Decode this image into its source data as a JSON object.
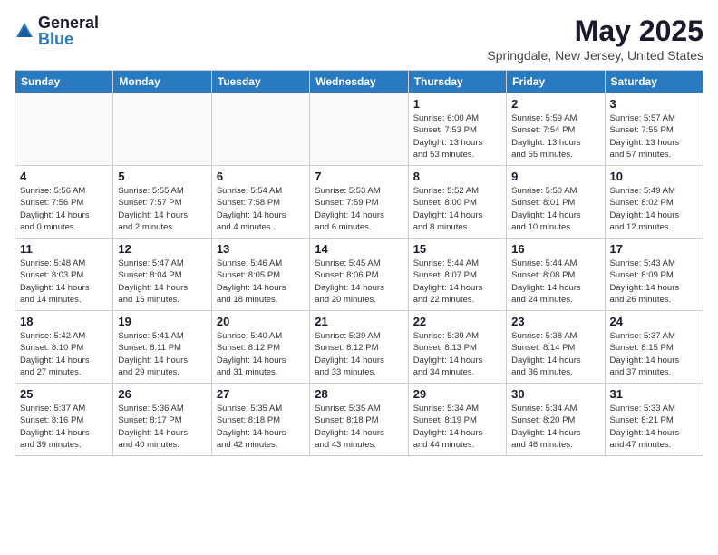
{
  "logo": {
    "general": "General",
    "blue": "Blue"
  },
  "title": {
    "month_year": "May 2025",
    "location": "Springdale, New Jersey, United States"
  },
  "days_of_week": [
    "Sunday",
    "Monday",
    "Tuesday",
    "Wednesday",
    "Thursday",
    "Friday",
    "Saturday"
  ],
  "weeks": [
    [
      {
        "day": "",
        "info": ""
      },
      {
        "day": "",
        "info": ""
      },
      {
        "day": "",
        "info": ""
      },
      {
        "day": "",
        "info": ""
      },
      {
        "day": "1",
        "info": "Sunrise: 6:00 AM\nSunset: 7:53 PM\nDaylight: 13 hours\nand 53 minutes."
      },
      {
        "day": "2",
        "info": "Sunrise: 5:59 AM\nSunset: 7:54 PM\nDaylight: 13 hours\nand 55 minutes."
      },
      {
        "day": "3",
        "info": "Sunrise: 5:57 AM\nSunset: 7:55 PM\nDaylight: 13 hours\nand 57 minutes."
      }
    ],
    [
      {
        "day": "4",
        "info": "Sunrise: 5:56 AM\nSunset: 7:56 PM\nDaylight: 14 hours\nand 0 minutes."
      },
      {
        "day": "5",
        "info": "Sunrise: 5:55 AM\nSunset: 7:57 PM\nDaylight: 14 hours\nand 2 minutes."
      },
      {
        "day": "6",
        "info": "Sunrise: 5:54 AM\nSunset: 7:58 PM\nDaylight: 14 hours\nand 4 minutes."
      },
      {
        "day": "7",
        "info": "Sunrise: 5:53 AM\nSunset: 7:59 PM\nDaylight: 14 hours\nand 6 minutes."
      },
      {
        "day": "8",
        "info": "Sunrise: 5:52 AM\nSunset: 8:00 PM\nDaylight: 14 hours\nand 8 minutes."
      },
      {
        "day": "9",
        "info": "Sunrise: 5:50 AM\nSunset: 8:01 PM\nDaylight: 14 hours\nand 10 minutes."
      },
      {
        "day": "10",
        "info": "Sunrise: 5:49 AM\nSunset: 8:02 PM\nDaylight: 14 hours\nand 12 minutes."
      }
    ],
    [
      {
        "day": "11",
        "info": "Sunrise: 5:48 AM\nSunset: 8:03 PM\nDaylight: 14 hours\nand 14 minutes."
      },
      {
        "day": "12",
        "info": "Sunrise: 5:47 AM\nSunset: 8:04 PM\nDaylight: 14 hours\nand 16 minutes."
      },
      {
        "day": "13",
        "info": "Sunrise: 5:46 AM\nSunset: 8:05 PM\nDaylight: 14 hours\nand 18 minutes."
      },
      {
        "day": "14",
        "info": "Sunrise: 5:45 AM\nSunset: 8:06 PM\nDaylight: 14 hours\nand 20 minutes."
      },
      {
        "day": "15",
        "info": "Sunrise: 5:44 AM\nSunset: 8:07 PM\nDaylight: 14 hours\nand 22 minutes."
      },
      {
        "day": "16",
        "info": "Sunrise: 5:44 AM\nSunset: 8:08 PM\nDaylight: 14 hours\nand 24 minutes."
      },
      {
        "day": "17",
        "info": "Sunrise: 5:43 AM\nSunset: 8:09 PM\nDaylight: 14 hours\nand 26 minutes."
      }
    ],
    [
      {
        "day": "18",
        "info": "Sunrise: 5:42 AM\nSunset: 8:10 PM\nDaylight: 14 hours\nand 27 minutes."
      },
      {
        "day": "19",
        "info": "Sunrise: 5:41 AM\nSunset: 8:11 PM\nDaylight: 14 hours\nand 29 minutes."
      },
      {
        "day": "20",
        "info": "Sunrise: 5:40 AM\nSunset: 8:12 PM\nDaylight: 14 hours\nand 31 minutes."
      },
      {
        "day": "21",
        "info": "Sunrise: 5:39 AM\nSunset: 8:12 PM\nDaylight: 14 hours\nand 33 minutes."
      },
      {
        "day": "22",
        "info": "Sunrise: 5:39 AM\nSunset: 8:13 PM\nDaylight: 14 hours\nand 34 minutes."
      },
      {
        "day": "23",
        "info": "Sunrise: 5:38 AM\nSunset: 8:14 PM\nDaylight: 14 hours\nand 36 minutes."
      },
      {
        "day": "24",
        "info": "Sunrise: 5:37 AM\nSunset: 8:15 PM\nDaylight: 14 hours\nand 37 minutes."
      }
    ],
    [
      {
        "day": "25",
        "info": "Sunrise: 5:37 AM\nSunset: 8:16 PM\nDaylight: 14 hours\nand 39 minutes."
      },
      {
        "day": "26",
        "info": "Sunrise: 5:36 AM\nSunset: 8:17 PM\nDaylight: 14 hours\nand 40 minutes."
      },
      {
        "day": "27",
        "info": "Sunrise: 5:35 AM\nSunset: 8:18 PM\nDaylight: 14 hours\nand 42 minutes."
      },
      {
        "day": "28",
        "info": "Sunrise: 5:35 AM\nSunset: 8:18 PM\nDaylight: 14 hours\nand 43 minutes."
      },
      {
        "day": "29",
        "info": "Sunrise: 5:34 AM\nSunset: 8:19 PM\nDaylight: 14 hours\nand 44 minutes."
      },
      {
        "day": "30",
        "info": "Sunrise: 5:34 AM\nSunset: 8:20 PM\nDaylight: 14 hours\nand 46 minutes."
      },
      {
        "day": "31",
        "info": "Sunrise: 5:33 AM\nSunset: 8:21 PM\nDaylight: 14 hours\nand 47 minutes."
      }
    ]
  ]
}
